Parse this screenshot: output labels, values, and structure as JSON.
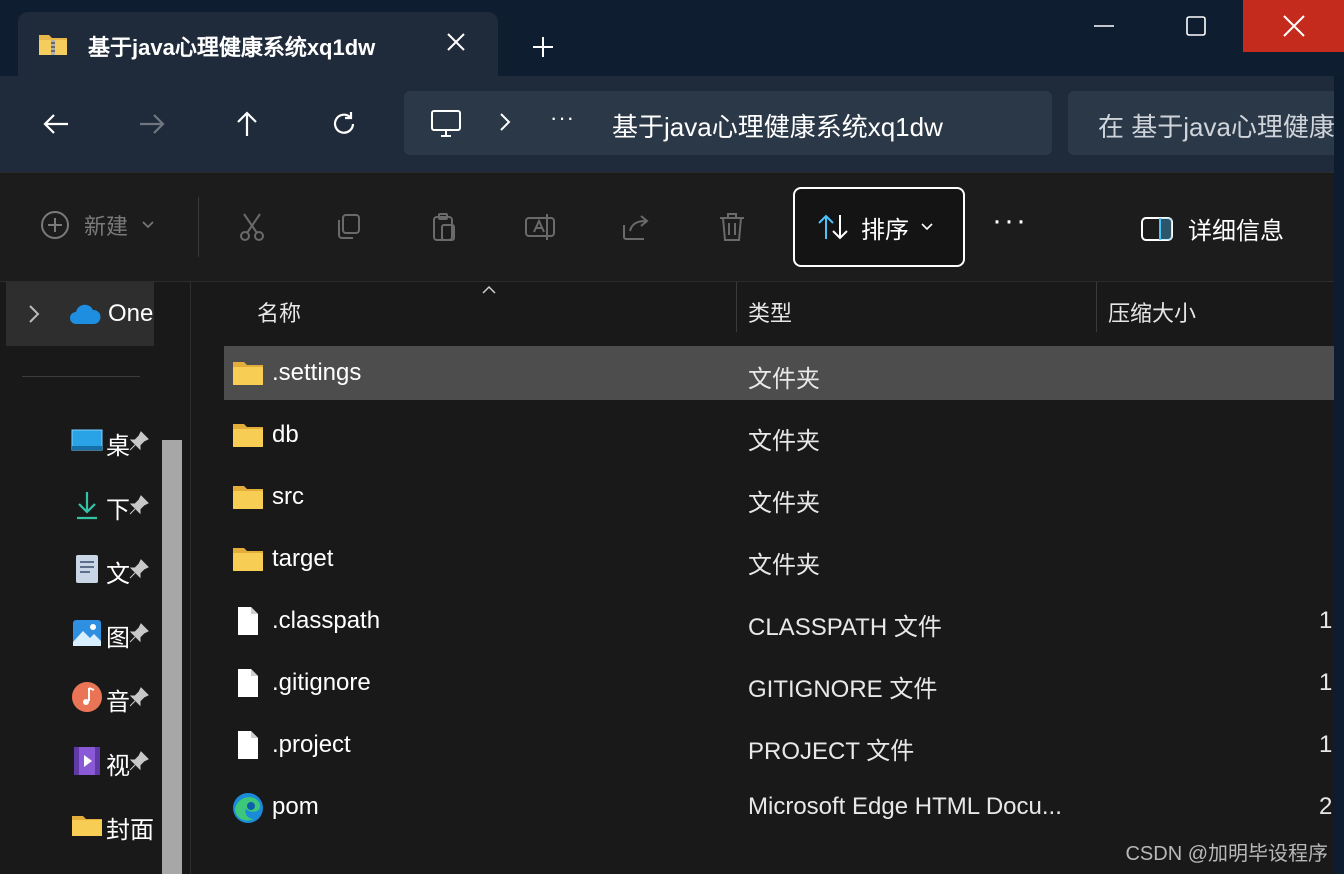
{
  "tab": {
    "title": "基于java心理健康系统xq1dw",
    "icon": "zip-folder-icon",
    "close_icon": "close-icon",
    "new_tab_icon": "plus-icon"
  },
  "window_controls": {
    "minimize": "minimize-icon",
    "maximize": "maximize-icon",
    "close": "close-icon",
    "close_color": "#c42b1c"
  },
  "navigation": {
    "back": "arrow-left-icon",
    "forward": "arrow-right-icon",
    "up": "arrow-up-icon",
    "refresh": "refresh-icon"
  },
  "address": {
    "more": "···",
    "path": "基于java心理健康系统xq1dw"
  },
  "search": {
    "placeholder": "在 基于java心理健康"
  },
  "toolbar": {
    "new_label": "新建",
    "sort_label": "排序",
    "more_label": "···",
    "details_label": "详细信息"
  },
  "sidebar": {
    "onedrive_label": "One",
    "items": [
      {
        "label": "桌",
        "icon": "desktop-icon"
      },
      {
        "label": "下",
        "icon": "download-icon"
      },
      {
        "label": "文",
        "icon": "documents-icon"
      },
      {
        "label": "图",
        "icon": "pictures-icon"
      },
      {
        "label": "音",
        "icon": "music-icon"
      },
      {
        "label": "视",
        "icon": "videos-icon"
      },
      {
        "label": "封面",
        "icon": "folder-icon"
      }
    ]
  },
  "columns": {
    "name": "名称",
    "type": "类型",
    "size": "压缩大小"
  },
  "files": [
    {
      "name": ".settings",
      "type": "文件夹",
      "size": "",
      "icon": "folder-icon",
      "selected": true
    },
    {
      "name": "db",
      "type": "文件夹",
      "size": "",
      "icon": "folder-icon"
    },
    {
      "name": "src",
      "type": "文件夹",
      "size": "",
      "icon": "folder-icon"
    },
    {
      "name": "target",
      "type": "文件夹",
      "size": "",
      "icon": "folder-icon"
    },
    {
      "name": ".classpath",
      "type": "CLASSPATH 文件",
      "size": "1",
      "icon": "file-icon"
    },
    {
      "name": ".gitignore",
      "type": "GITIGNORE 文件",
      "size": "1",
      "icon": "file-icon"
    },
    {
      "name": ".project",
      "type": "PROJECT 文件",
      "size": "1",
      "icon": "file-icon"
    },
    {
      "name": "pom",
      "type": "Microsoft Edge HTML Docu...",
      "size": "2",
      "icon": "edge-icon"
    }
  ],
  "watermark": "CSDN @加明毕设程序"
}
